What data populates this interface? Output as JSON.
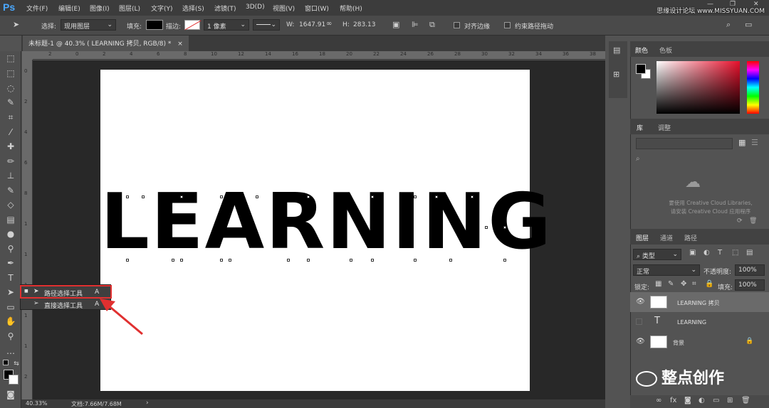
{
  "app": {
    "logo": "Ps",
    "menu": [
      "文件(F)",
      "编辑(E)",
      "图像(I)",
      "图层(L)",
      "文字(Y)",
      "选择(S)",
      "滤镜(T)",
      "3D(D)",
      "视图(V)",
      "窗口(W)",
      "帮助(H)"
    ],
    "window_controls": [
      "—",
      "❐",
      "✕"
    ],
    "watermark_top": "思缘设计论坛 www.MISSYUAN.COM"
  },
  "options": {
    "select_label": "选择:",
    "select_value": "现用图层",
    "fill_label": "填充:",
    "stroke_label": "描边:",
    "stroke_width": "1 像素",
    "w_label": "W:",
    "w_value": "1647.91",
    "h_label": "H:",
    "h_value": "283.13",
    "align_edges": "对齐边缘",
    "constrain_path": "约束路径拖动"
  },
  "document": {
    "tab_title": "未标题-1 @ 40.3% ( LEARNING 拷贝, RGB/8) *",
    "close": "×",
    "canvas_text": "LEARNING",
    "ruler_top_ticks": [
      "2",
      "0",
      "2",
      "4",
      "6",
      "8",
      "10",
      "12",
      "14",
      "16",
      "18",
      "20",
      "22",
      "24",
      "26",
      "28",
      "30",
      "32",
      "34",
      "36",
      "38"
    ],
    "ruler_left_ticks": [
      "0",
      "2",
      "4",
      "6",
      "8",
      "1",
      "1",
      "1",
      "1",
      "1",
      "2"
    ]
  },
  "status": {
    "zoom": "40.33%",
    "doc": "文档:7.66M/7.68M"
  },
  "flyout": {
    "items": [
      {
        "label": "路径选择工具",
        "shortcut": "A"
      },
      {
        "label": "直接选择工具",
        "shortcut": "A"
      }
    ]
  },
  "panels": {
    "color_tabs": [
      "颜色",
      "色板"
    ],
    "library_tabs": [
      "库",
      "调整"
    ],
    "cc_message_line1": "要使用 Creative Cloud Libraries,",
    "cc_message_line2": "请安装 Creative Cloud 应用程序",
    "layers_tabs": [
      "图层",
      "通道",
      "路径"
    ],
    "kind_label": "类型",
    "blend_mode": "正常",
    "opacity_label": "不透明度:",
    "opacity_value": "100%",
    "lock_label": "锁定:",
    "fill_label": "填充:",
    "fill_value": "100%",
    "layers": [
      {
        "name": "LEARNING 拷贝",
        "visible": true,
        "selected": true
      },
      {
        "name": "LEARNING",
        "visible": false,
        "selected": false
      },
      {
        "name": "背景",
        "visible": true,
        "selected": false
      }
    ],
    "footer_icons": [
      "link-icon",
      "fx-icon",
      "mask-icon",
      "adjustment-icon",
      "folder-icon",
      "new-layer-icon",
      "trash-icon"
    ]
  },
  "watermark": "整点创作",
  "colors": {
    "highlight_red": "#e03030",
    "ps_blue": "#4aa8ff"
  }
}
